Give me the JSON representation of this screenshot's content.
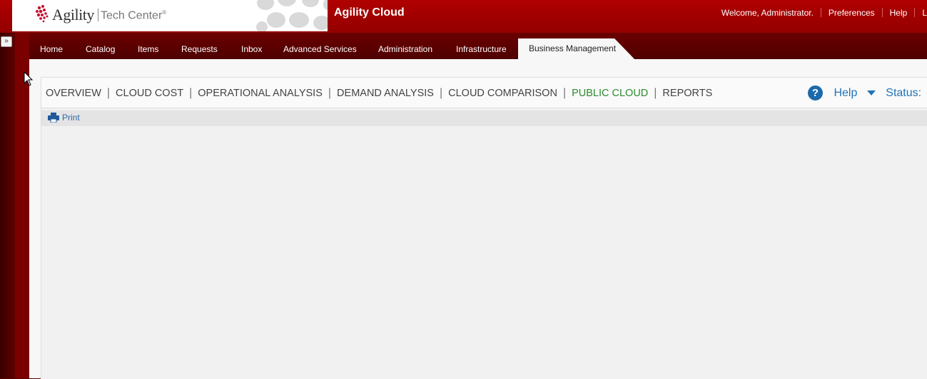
{
  "header": {
    "logo_name": "Agility",
    "logo_sub": "Tech Center",
    "logo_reg": "®",
    "app_title": "Agility Cloud",
    "links": [
      "Welcome, Administrator.",
      "Preferences",
      "Help",
      "L"
    ]
  },
  "sidebar": {
    "expand_icon": "double-chevron-right-icon",
    "expand_glyph": "»"
  },
  "nav": {
    "tabs": [
      "Home",
      "Catalog",
      "Items",
      "Requests",
      "Inbox",
      "Advanced Services",
      "Administration",
      "Infrastructure",
      "Business Management"
    ],
    "active": "Business Management"
  },
  "subnav": {
    "items": [
      "OVERVIEW",
      "CLOUD COST",
      "OPERATIONAL ANALYSIS",
      "DEMAND ANALYSIS",
      "CLOUD COMPARISON",
      "PUBLIC CLOUD",
      "REPORTS"
    ],
    "current": "PUBLIC CLOUD",
    "separator": "|",
    "help_icon": "question-icon",
    "help_glyph": "?",
    "help_label": "Help",
    "status_label": "Status:"
  },
  "toolbar": {
    "print_label": "Print",
    "print_icon": "printer-icon"
  },
  "colors": {
    "header_red": "#a80000",
    "nav_dark": "#5a0000",
    "current_green": "#2e8b2e",
    "link_blue": "#2273b7"
  }
}
